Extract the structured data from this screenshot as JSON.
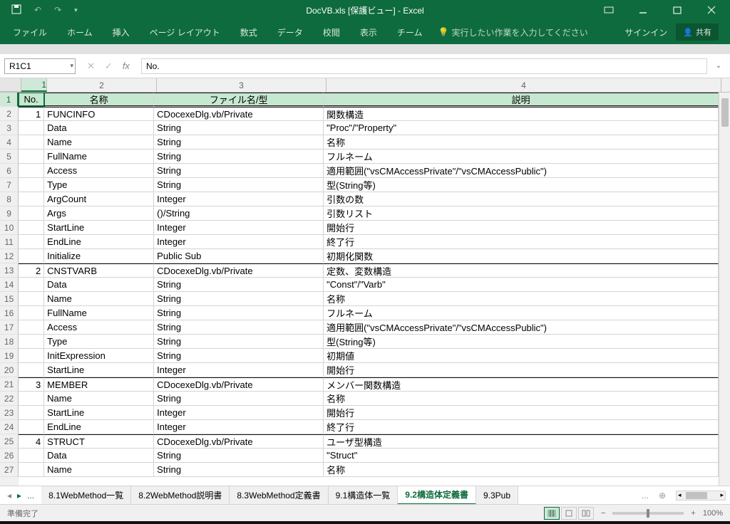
{
  "window": {
    "title": "DocVB.xls [保護ビュー] - Excel"
  },
  "ribbon": {
    "tabs": [
      "ファイル",
      "ホーム",
      "挿入",
      "ページ レイアウト",
      "数式",
      "データ",
      "校閲",
      "表示",
      "チーム"
    ],
    "tellme": "実行したい作業を入力してください",
    "signin": "サインイン",
    "share": "共有"
  },
  "formula": {
    "nameBox": "R1C1",
    "value": "No."
  },
  "columns": {
    "numbers": [
      "1",
      "2",
      "3",
      "4"
    ],
    "headers": [
      "No.",
      "名称",
      "ファイル名/型",
      "説明"
    ],
    "activeIndex": 0
  },
  "rows": [
    {
      "r": 2,
      "no": "1",
      "name": "FUNCINFO",
      "file": "CDocexeDlg.vb/Private",
      "desc": "関数構造",
      "thick": true
    },
    {
      "r": 3,
      "no": "",
      "name": "Data",
      "file": "String",
      "desc": "\"Proc\"/\"Property\""
    },
    {
      "r": 4,
      "no": "",
      "name": "Name",
      "file": "String",
      "desc": "名称"
    },
    {
      "r": 5,
      "no": "",
      "name": "FullName",
      "file": "String",
      "desc": "フルネーム"
    },
    {
      "r": 6,
      "no": "",
      "name": "Access",
      "file": "String",
      "desc": "適用範囲(\"vsCMAccessPrivate\"/\"vsCMAccessPublic\")"
    },
    {
      "r": 7,
      "no": "",
      "name": "Type",
      "file": "String",
      "desc": "型(String等)"
    },
    {
      "r": 8,
      "no": "",
      "name": "ArgCount",
      "file": "Integer",
      "desc": "引数の数"
    },
    {
      "r": 9,
      "no": "",
      "name": "Args",
      "file": "()/String",
      "desc": "引数リスト"
    },
    {
      "r": 10,
      "no": "",
      "name": "StartLine",
      "file": "Integer",
      "desc": "開始行"
    },
    {
      "r": 11,
      "no": "",
      "name": "EndLine",
      "file": "Integer",
      "desc": "終了行"
    },
    {
      "r": 12,
      "no": "",
      "name": "Initialize",
      "file": "Public Sub",
      "desc": "初期化関数"
    },
    {
      "r": 13,
      "no": "2",
      "name": "CNSTVARB",
      "file": "CDocexeDlg.vb/Private",
      "desc": "定数、変数構造",
      "thick": true
    },
    {
      "r": 14,
      "no": "",
      "name": "Data",
      "file": "String",
      "desc": "\"Const\"/\"Varb\""
    },
    {
      "r": 15,
      "no": "",
      "name": "Name",
      "file": "String",
      "desc": "名称"
    },
    {
      "r": 16,
      "no": "",
      "name": "FullName",
      "file": "String",
      "desc": "フルネーム"
    },
    {
      "r": 17,
      "no": "",
      "name": "Access",
      "file": "String",
      "desc": "適用範囲(\"vsCMAccessPrivate\"/\"vsCMAccessPublic\")"
    },
    {
      "r": 18,
      "no": "",
      "name": "Type",
      "file": "String",
      "desc": "型(String等)"
    },
    {
      "r": 19,
      "no": "",
      "name": "InitExpression",
      "file": "String",
      "desc": "初期値"
    },
    {
      "r": 20,
      "no": "",
      "name": "StartLine",
      "file": "Integer",
      "desc": "開始行"
    },
    {
      "r": 21,
      "no": "3",
      "name": "MEMBER",
      "file": "CDocexeDlg.vb/Private",
      "desc": "メンバー関数構造",
      "thick": true
    },
    {
      "r": 22,
      "no": "",
      "name": "Name",
      "file": "String",
      "desc": "名称"
    },
    {
      "r": 23,
      "no": "",
      "name": "StartLine",
      "file": "Integer",
      "desc": "開始行"
    },
    {
      "r": 24,
      "no": "",
      "name": "EndLine",
      "file": "Integer",
      "desc": "終了行"
    },
    {
      "r": 25,
      "no": "4",
      "name": "STRUCT",
      "file": "CDocexeDlg.vb/Private",
      "desc": "ユーザ型構造",
      "thick": true
    },
    {
      "r": 26,
      "no": "",
      "name": "Data",
      "file": "String",
      "desc": "\"Struct\""
    },
    {
      "r": 27,
      "no": "",
      "name": "Name",
      "file": "String",
      "desc": "名称"
    }
  ],
  "sheets": {
    "ellipsis": "...",
    "tabs": [
      "8.1WebMethod一覧",
      "8.2WebMethod説明書",
      "8.3WebMethod定義書",
      "9.1構造体一覧",
      "9.2構造体定義書",
      "9.3Pub"
    ],
    "activeIndex": 4,
    "truncated": "..."
  },
  "status": {
    "left": "準備完了",
    "zoom": "100%"
  }
}
